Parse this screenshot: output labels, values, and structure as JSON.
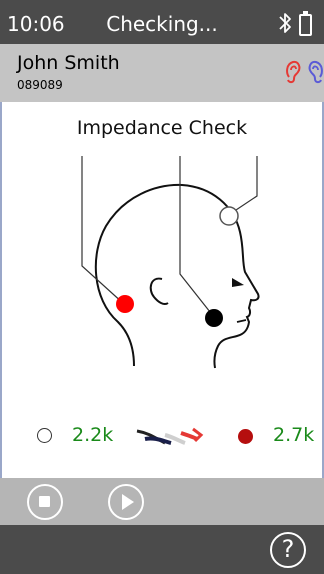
{
  "status_bar": {
    "time": "10:06",
    "title": "Checking...",
    "icons": [
      "bluetooth-icon",
      "battery-icon"
    ]
  },
  "patient": {
    "name": "John Smith",
    "id": "089089",
    "icons": [
      "right-ear-icon",
      "left-ear-icon"
    ],
    "right_ear_color": "#e53935",
    "left_ear_color": "#5b5bd6"
  },
  "check": {
    "heading": "Impedance Check",
    "reference_electrode_color": "#ffffff",
    "active_electrode_color": "#ff0000",
    "ground_electrode_color": "#000000"
  },
  "readings": {
    "left_value": "2.2k",
    "right_value": "2.7k",
    "value_color": "#1a8a1a",
    "right_marker_color": "#b50e0e"
  },
  "controls": {
    "icons": [
      "stop-icon",
      "play-icon"
    ]
  },
  "bottom_bar": {
    "help_label": "?"
  }
}
